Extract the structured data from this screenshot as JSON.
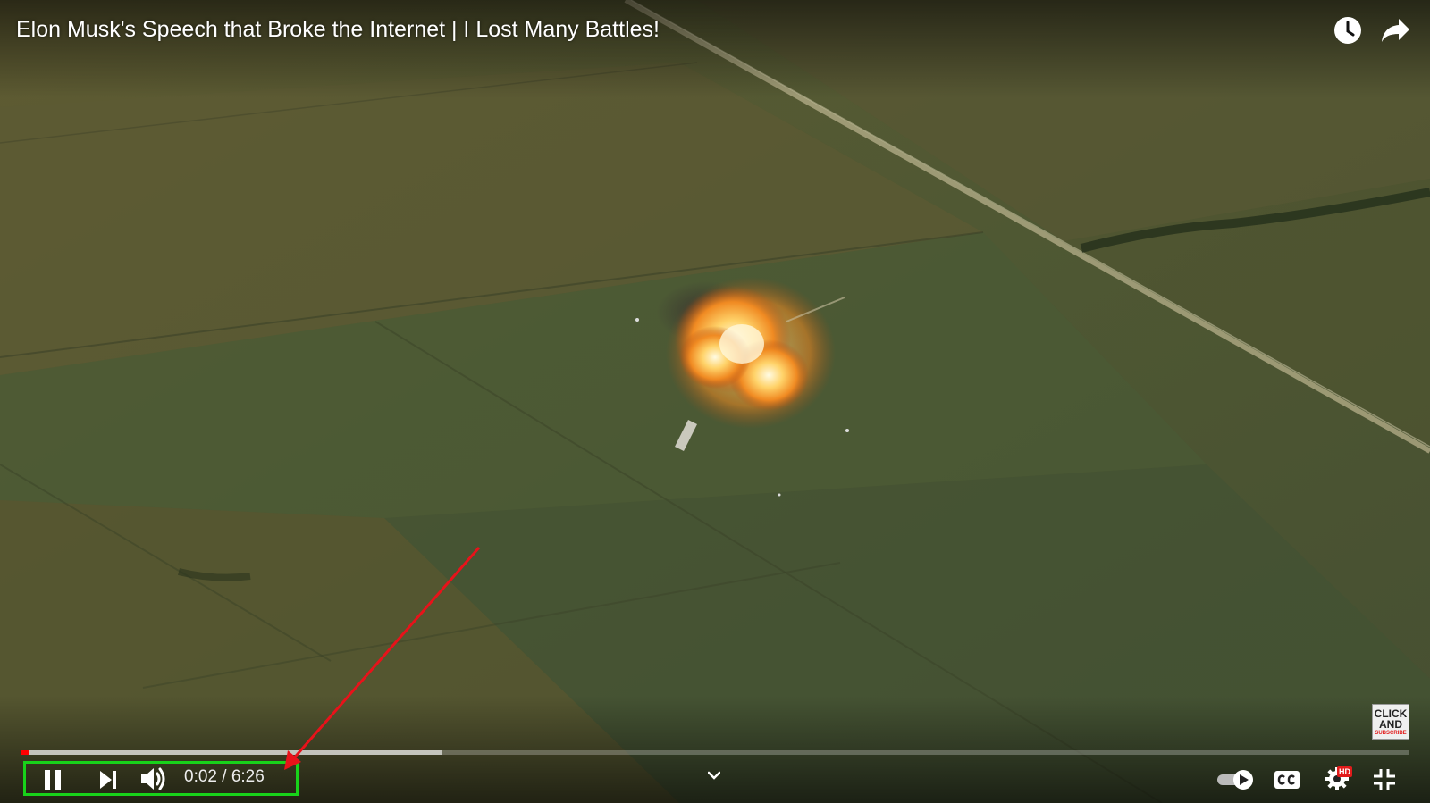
{
  "video": {
    "title": "Elon Musk's Speech that Broke the Internet | I Lost Many Battles!",
    "current_time": "0:02",
    "separator": "/",
    "duration": "6:26",
    "played_fraction": 0.0053,
    "buffered_fraction": 0.303
  },
  "top_controls": {
    "watch_later_icon": "clock-icon",
    "share_icon": "share-arrow-icon"
  },
  "controls": {
    "play_state": "playing",
    "pause_icon": "pause-icon",
    "next_icon": "skip-next-icon",
    "volume_icon": "volume-icon",
    "chevron_icon": "chevron-down-icon",
    "autoplay_toggle_icon": "autoplay-toggle-icon",
    "subtitles_icon": "cc-icon",
    "settings_icon": "gear-icon",
    "fullscreen_exit_icon": "exit-fullscreen-icon",
    "quality_badge": "HD"
  },
  "watermark": {
    "line1": "CLICK",
    "line2": "AND",
    "line3": "SUBSCRIBE"
  },
  "colors": {
    "progress_played": "#ff0000",
    "highlight_box": "#18d21a",
    "annotation_arrow": "#e8121a",
    "hd_badge": "#e21b1b"
  }
}
